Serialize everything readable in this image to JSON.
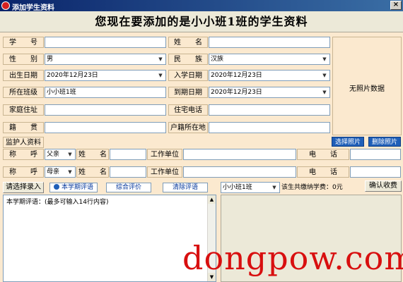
{
  "window": {
    "title": "添加学生资料",
    "close_glyph": "×"
  },
  "header": {
    "text": "您现在要添加的是小小班1班的学生资料"
  },
  "fields": {
    "student_id": {
      "label": "学　　号",
      "value": ""
    },
    "name": {
      "label": "姓　　名",
      "value": ""
    },
    "gender": {
      "label": "性　　别",
      "value": "男"
    },
    "ethnicity": {
      "label": "民　　族",
      "value": "汉族"
    },
    "birth_date": {
      "label": "出生日期",
      "value": "2020年12月23日"
    },
    "enroll_date": {
      "label": "入学日期",
      "value": "2020年12月23日"
    },
    "class": {
      "label": "所在班级",
      "value": "小小班1班"
    },
    "expire_date": {
      "label": "到期日期",
      "value": "2020年12月23日"
    },
    "home_address": {
      "label": "家庭住址",
      "value": ""
    },
    "home_phone": {
      "label": "住宅电话",
      "value": ""
    },
    "native_place": {
      "label": "籍　　贯",
      "value": ""
    },
    "hukou_location": {
      "label": "户籍所在地",
      "value": ""
    }
  },
  "photo": {
    "placeholder": "无照片数据",
    "select_label": "选择照片",
    "delete_label": "删除照片"
  },
  "guardian": {
    "section_label": "监护人资料",
    "rows": [
      {
        "title_label": "称　　呼",
        "relation": "父亲",
        "name_label": "姓　　名",
        "name": "",
        "work_label": "工作单位",
        "work": "",
        "phone_label": "电　　话",
        "phone": ""
      },
      {
        "title_label": "称　　呼",
        "relation": "母亲",
        "name_label": "姓　　名",
        "name": "",
        "work_label": "工作单位",
        "work": "",
        "phone_label": "电　　话",
        "phone": ""
      }
    ]
  },
  "toolbar": {
    "select_entry": "请选择录入",
    "semester_comment": "本学期评语",
    "overall_eval": "综合评价",
    "clear_comment": "清除评语",
    "class_select": "小小班1班",
    "fee_text": "该生共缴纳学费：0元",
    "confirm_fee": "确认收费"
  },
  "comment": {
    "hint": "本学期评语：(最多可输入14行内容)"
  },
  "icons": {
    "dropdown": "▼",
    "up": "▲",
    "down": "▼"
  },
  "watermark": "dongpow.com"
}
